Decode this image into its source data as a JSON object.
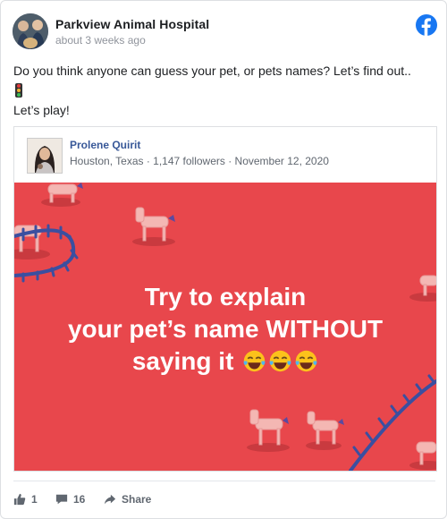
{
  "post": {
    "page_name": "Parkview Animal Hospital",
    "time": "about 3 weeks ago",
    "text_line1": "Do you think anyone can guess your pet, or pets names? Let’s find out..",
    "text_line3": "Let’s play!"
  },
  "shared": {
    "author": "Prolene Quirit",
    "meta": "Houston, Texas · 1,147 followers · November 12, 2020",
    "headline_line1": "Try to explain",
    "headline_line2": "your pet’s name WITHOUT",
    "headline_line3": "saying it"
  },
  "actions": {
    "like_count": "1",
    "comment_count": "16",
    "share_label": "Share"
  },
  "colors": {
    "facebook_blue": "#1877f2",
    "image_background": "#e8474c",
    "link_blue": "#385898"
  },
  "icons": [
    "facebook-logo-icon",
    "traffic-light-icon",
    "like-icon",
    "comment-icon",
    "share-icon",
    "laughing-emoji-icon"
  ]
}
